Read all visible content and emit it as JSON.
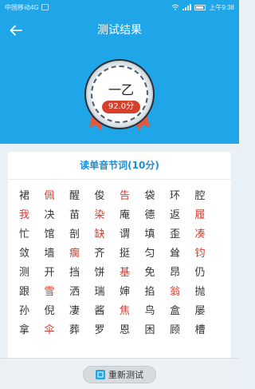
{
  "status_bar": {
    "carrier": "中国移动4G",
    "time": "上午9:38"
  },
  "header": {
    "title": "测试结果"
  },
  "result": {
    "grade": "一乙",
    "score": "92.0分"
  },
  "card": {
    "title": "读单音节词(10分)"
  },
  "characters": [
    {
      "char": "裙",
      "wrong": false
    },
    {
      "char": "佩",
      "wrong": true
    },
    {
      "char": "醒",
      "wrong": false
    },
    {
      "char": "俊",
      "wrong": false
    },
    {
      "char": "告",
      "wrong": true
    },
    {
      "char": "袋",
      "wrong": false
    },
    {
      "char": "环",
      "wrong": false
    },
    {
      "char": "腔",
      "wrong": false
    },
    {
      "char": "我",
      "wrong": true
    },
    {
      "char": "决",
      "wrong": false
    },
    {
      "char": "苗",
      "wrong": false
    },
    {
      "char": "染",
      "wrong": true
    },
    {
      "char": "庵",
      "wrong": false
    },
    {
      "char": "德",
      "wrong": false
    },
    {
      "char": "返",
      "wrong": false
    },
    {
      "char": "履",
      "wrong": true
    },
    {
      "char": "忙",
      "wrong": false
    },
    {
      "char": "馆",
      "wrong": false
    },
    {
      "char": "剖",
      "wrong": false
    },
    {
      "char": "缺",
      "wrong": true
    },
    {
      "char": "谓",
      "wrong": false
    },
    {
      "char": "填",
      "wrong": false
    },
    {
      "char": "歪",
      "wrong": false
    },
    {
      "char": "凑",
      "wrong": true
    },
    {
      "char": "敛",
      "wrong": false
    },
    {
      "char": "墙",
      "wrong": false
    },
    {
      "char": "瘸",
      "wrong": true
    },
    {
      "char": "齐",
      "wrong": false
    },
    {
      "char": "挺",
      "wrong": false
    },
    {
      "char": "匀",
      "wrong": false
    },
    {
      "char": "耸",
      "wrong": false
    },
    {
      "char": "钧",
      "wrong": true
    },
    {
      "char": "测",
      "wrong": false
    },
    {
      "char": "开",
      "wrong": false
    },
    {
      "char": "挡",
      "wrong": false
    },
    {
      "char": "饼",
      "wrong": false
    },
    {
      "char": "基",
      "wrong": true
    },
    {
      "char": "免",
      "wrong": false
    },
    {
      "char": "昂",
      "wrong": false
    },
    {
      "char": "仍",
      "wrong": false
    },
    {
      "char": "跟",
      "wrong": false
    },
    {
      "char": "雪",
      "wrong": true
    },
    {
      "char": "洒",
      "wrong": false
    },
    {
      "char": "瑞",
      "wrong": false
    },
    {
      "char": "婶",
      "wrong": false
    },
    {
      "char": "掐",
      "wrong": false
    },
    {
      "char": "翁",
      "wrong": true
    },
    {
      "char": "抛",
      "wrong": false
    },
    {
      "char": "孙",
      "wrong": false
    },
    {
      "char": "倪",
      "wrong": false
    },
    {
      "char": "凄",
      "wrong": false
    },
    {
      "char": "酱",
      "wrong": false
    },
    {
      "char": "焦",
      "wrong": true
    },
    {
      "char": "鸟",
      "wrong": false
    },
    {
      "char": "盒",
      "wrong": false
    },
    {
      "char": "屡",
      "wrong": false
    },
    {
      "char": "拿",
      "wrong": false
    },
    {
      "char": "伞",
      "wrong": true
    },
    {
      "char": "葬",
      "wrong": false
    },
    {
      "char": "罗",
      "wrong": false
    },
    {
      "char": "恩",
      "wrong": false
    },
    {
      "char": "困",
      "wrong": false
    },
    {
      "char": "顾",
      "wrong": false
    },
    {
      "char": "槽",
      "wrong": false
    }
  ],
  "bottom": {
    "retest_label": "重新测试"
  },
  "colors": {
    "accent": "#1ea6e9",
    "wrong": "#d63a2d",
    "score_pill": "#d6412d",
    "title_blue": "#1b8fd4"
  }
}
